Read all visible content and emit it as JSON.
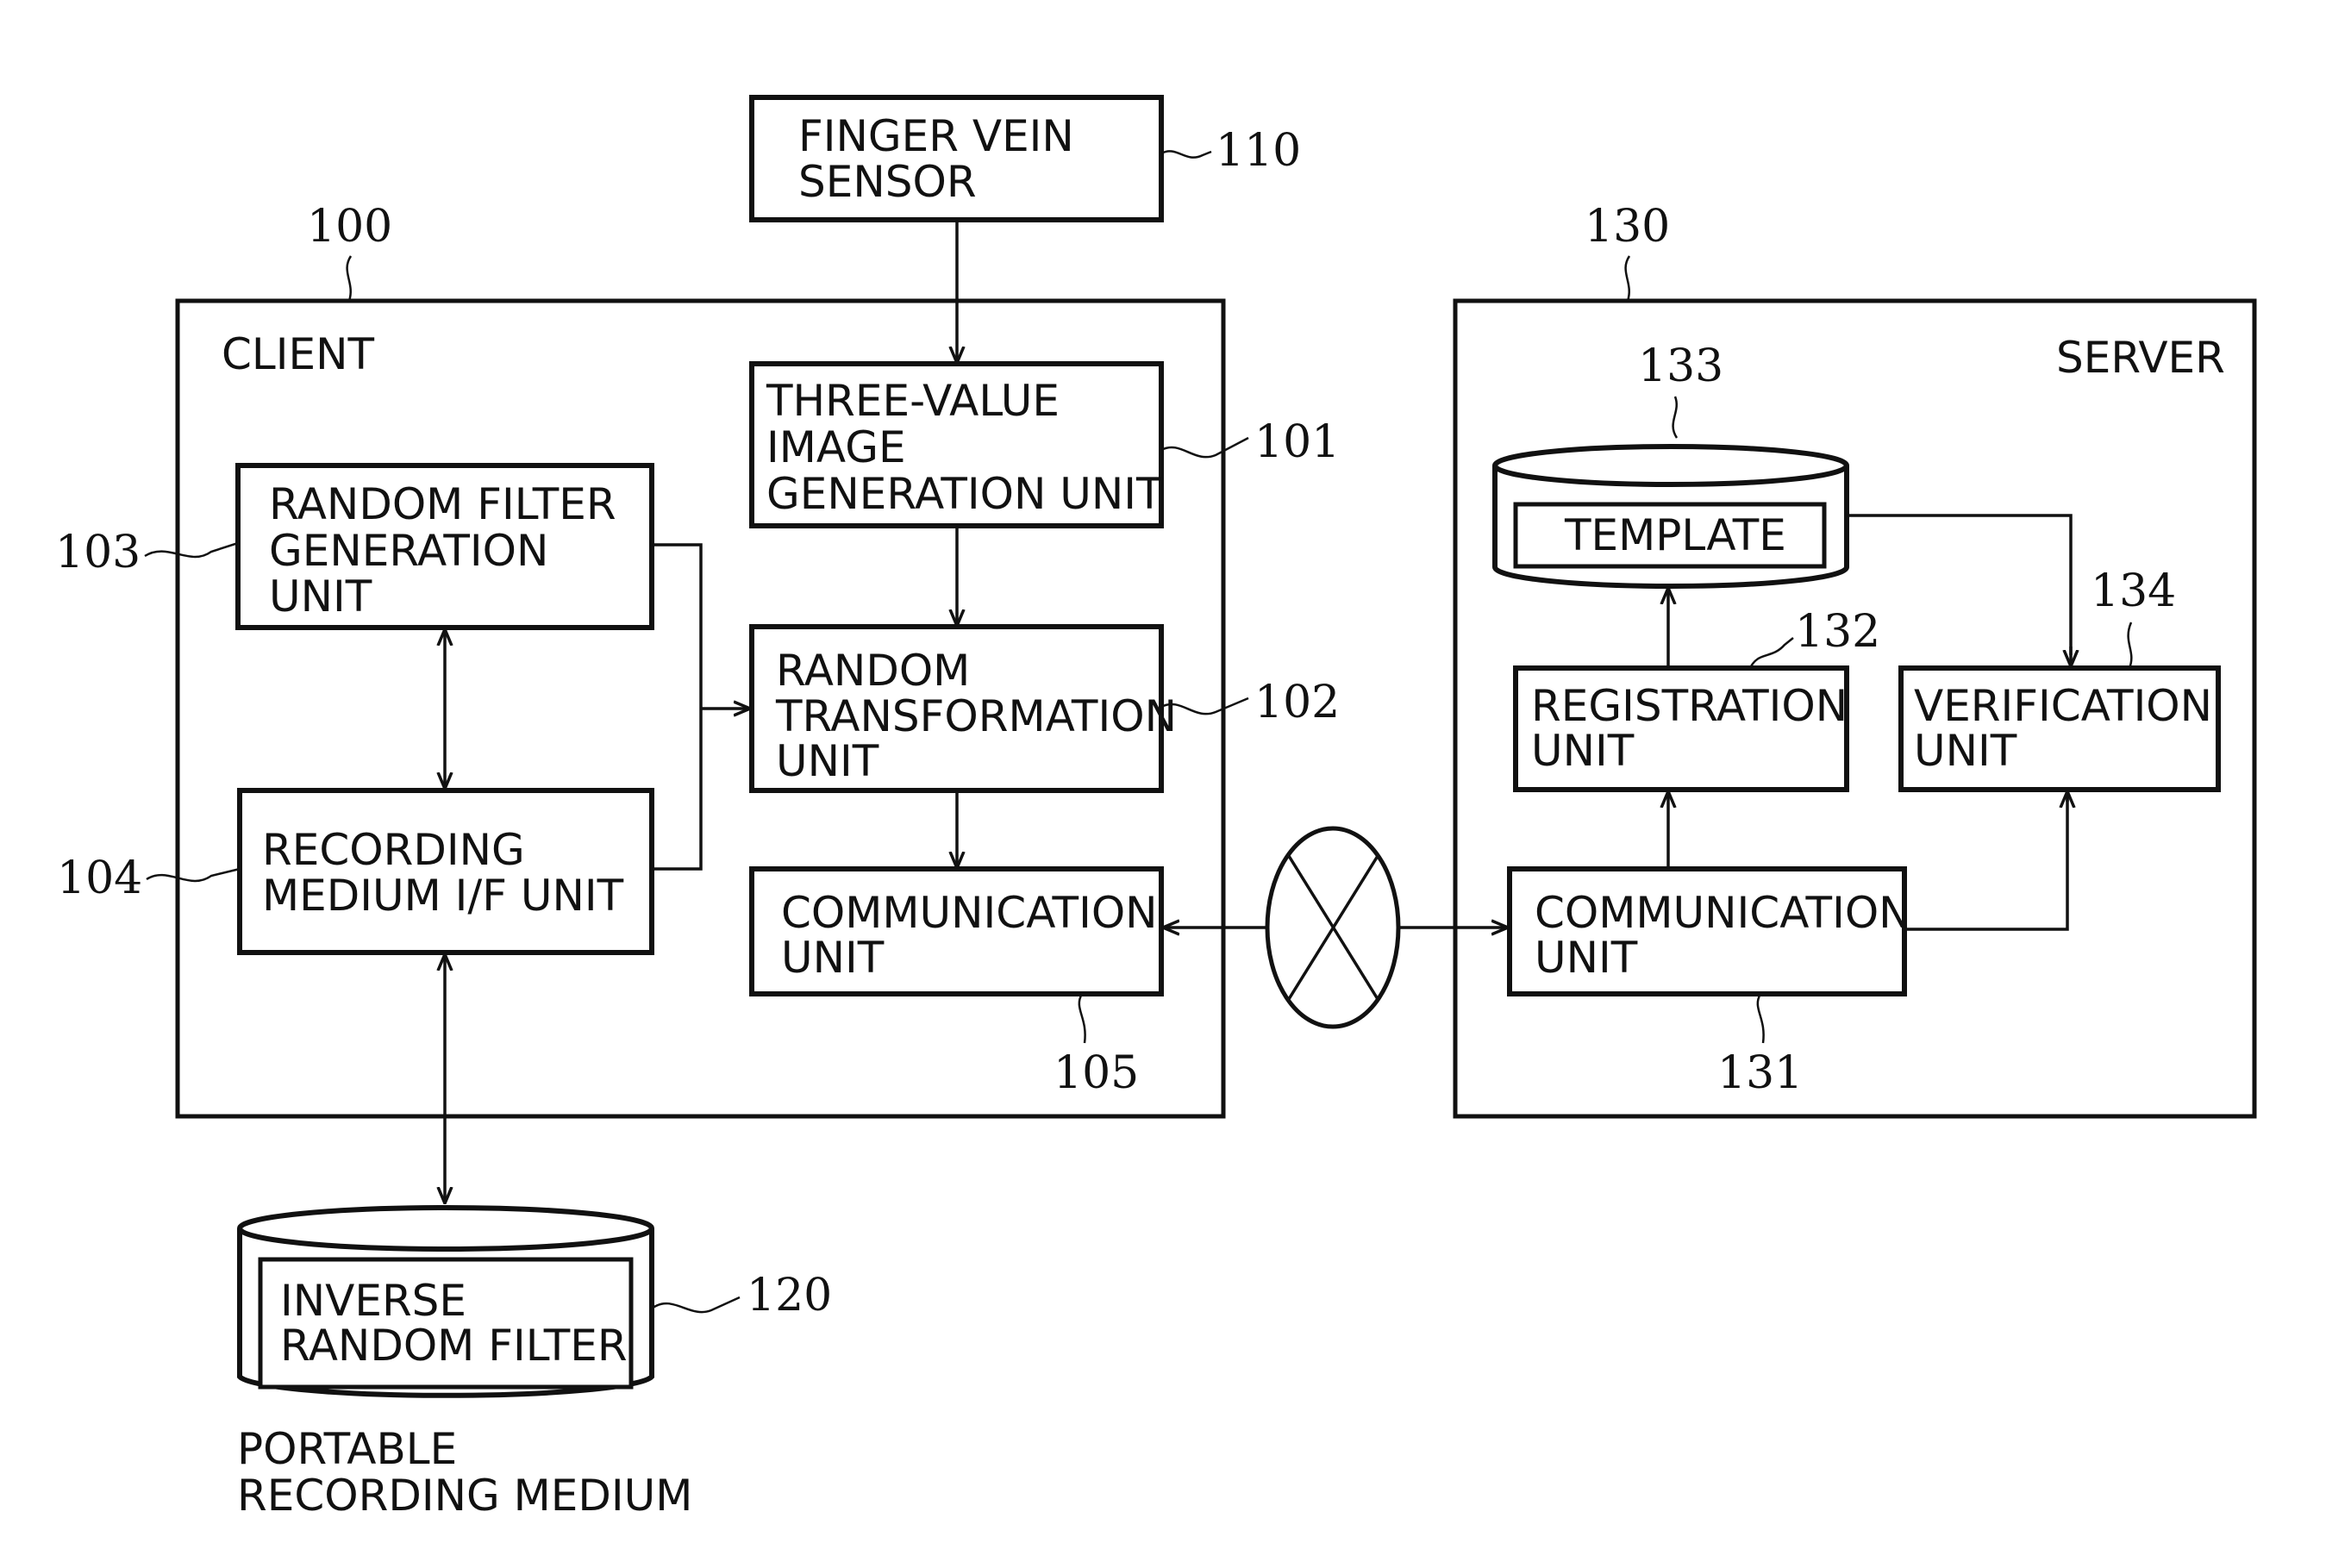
{
  "diagram": {
    "type": "block-diagram",
    "client": {
      "title": "CLIENT",
      "ref": "100",
      "units": {
        "three_value": {
          "lines": [
            "THREE-VALUE",
            "IMAGE",
            "GENERATION UNIT"
          ],
          "ref": "101"
        },
        "random_transformation": {
          "lines": [
            "RANDOM",
            "TRANSFORMATION",
            "UNIT"
          ],
          "ref": "102"
        },
        "random_filter_generation": {
          "lines": [
            "RANDOM FILTER",
            "GENERATION",
            "UNIT"
          ],
          "ref": "103"
        },
        "recording_medium_if": {
          "lines": [
            "RECORDING",
            "MEDIUM I/F UNIT"
          ],
          "ref": "104"
        },
        "communication": {
          "lines": [
            "COMMUNICATION",
            "UNIT"
          ],
          "ref": "105"
        }
      }
    },
    "finger_vein_sensor": {
      "lines": [
        "FINGER VEIN",
        "SENSOR"
      ],
      "ref": "110"
    },
    "portable_recording_medium": {
      "content_lines": [
        "INVERSE",
        "RANDOM FILTER"
      ],
      "caption_lines": [
        "PORTABLE",
        "RECORDING MEDIUM"
      ],
      "ref": "120"
    },
    "server": {
      "title": "SERVER",
      "ref": "130",
      "units": {
        "communication": {
          "lines": [
            "COMMUNICATION",
            "UNIT"
          ],
          "ref": "131"
        },
        "registration": {
          "lines": [
            "REGISTRATION",
            "UNIT"
          ],
          "ref": "132"
        },
        "template_db": {
          "lines": [
            "TEMPLATE"
          ],
          "ref": "133"
        },
        "verification": {
          "lines": [
            "VERIFICATION",
            "UNIT"
          ],
          "ref": "134"
        }
      }
    },
    "network_icon": "network-crossed-ellipse-icon",
    "connections": [
      {
        "from": "FINGER VEIN SENSOR",
        "to": "THREE-VALUE IMAGE GENERATION UNIT",
        "direction": "one-way"
      },
      {
        "from": "THREE-VALUE IMAGE GENERATION UNIT",
        "to": "RANDOM TRANSFORMATION UNIT",
        "direction": "one-way"
      },
      {
        "from": "RANDOM FILTER GENERATION UNIT",
        "to": "RANDOM TRANSFORMATION UNIT",
        "direction": "one-way"
      },
      {
        "from": "RECORDING MEDIUM I/F UNIT",
        "to": "RANDOM TRANSFORMATION UNIT",
        "direction": "one-way"
      },
      {
        "from": "RANDOM FILTER GENERATION UNIT",
        "to": "RECORDING MEDIUM I/F UNIT",
        "direction": "two-way"
      },
      {
        "from": "RECORDING MEDIUM I/F UNIT",
        "to": "PORTABLE RECORDING MEDIUM",
        "direction": "two-way"
      },
      {
        "from": "RANDOM TRANSFORMATION UNIT",
        "to": "COMMUNICATION UNIT (105)",
        "direction": "one-way"
      },
      {
        "from": "COMMUNICATION UNIT (105)",
        "to": "COMMUNICATION UNIT (131)",
        "direction": "two-way",
        "via": "network"
      },
      {
        "from": "COMMUNICATION UNIT (131)",
        "to": "REGISTRATION UNIT",
        "direction": "one-way"
      },
      {
        "from": "COMMUNICATION UNIT (131)",
        "to": "VERIFICATION UNIT",
        "direction": "one-way"
      },
      {
        "from": "REGISTRATION UNIT",
        "to": "TEMPLATE",
        "direction": "one-way"
      },
      {
        "from": "TEMPLATE",
        "to": "VERIFICATION UNIT",
        "direction": "one-way"
      }
    ]
  }
}
